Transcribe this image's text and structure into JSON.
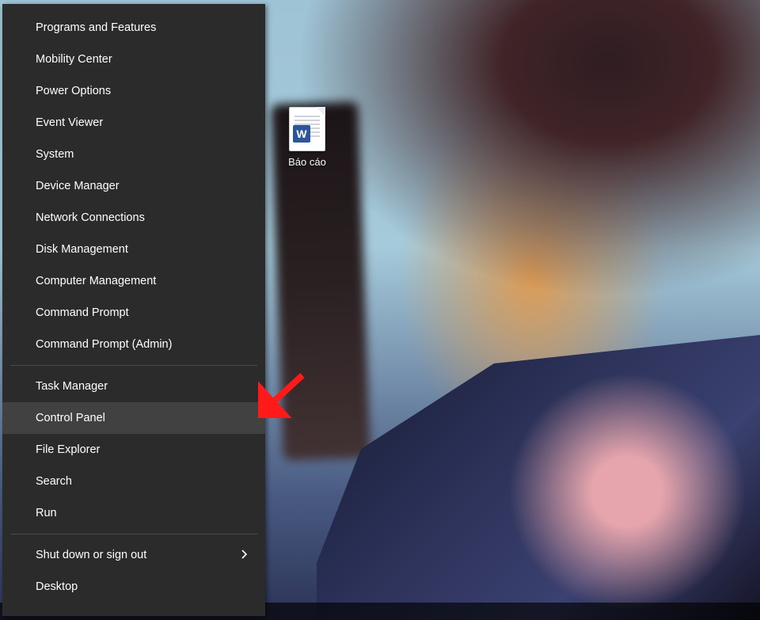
{
  "desktop": {
    "file_label": "Báo cáo",
    "doc_badge_letter": "W"
  },
  "power_menu": {
    "group1": [
      "Programs and Features",
      "Mobility Center",
      "Power Options",
      "Event Viewer",
      "System",
      "Device Manager",
      "Network Connections",
      "Disk Management",
      "Computer Management",
      "Command Prompt",
      "Command Prompt (Admin)"
    ],
    "group2": [
      "Task Manager",
      "Control Panel",
      "File Explorer",
      "Search",
      "Run"
    ],
    "group3": [
      {
        "label": "Shut down or sign out",
        "submenu": true
      },
      {
        "label": "Desktop",
        "submenu": false
      }
    ],
    "hovered_item": "Control Panel"
  }
}
